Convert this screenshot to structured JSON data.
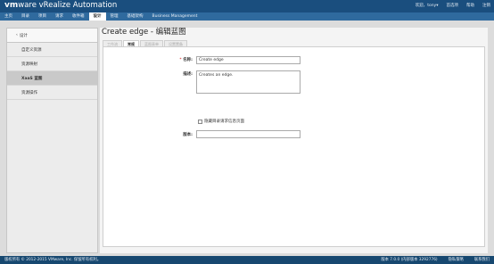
{
  "app": {
    "brand_vm": "vm",
    "brand_ware": "ware",
    "product": " vRealize Automation"
  },
  "header": {
    "user": "欢迎，",
    "user_name": "tony",
    "preferences": "首选项",
    "help": "帮助",
    "logout": "注销"
  },
  "nav": {
    "items": [
      {
        "label": "主页",
        "active": false
      },
      {
        "label": "目录",
        "active": false
      },
      {
        "label": "项目",
        "active": false
      },
      {
        "label": "请求",
        "active": false
      },
      {
        "label": "收件箱",
        "active": false
      },
      {
        "label": "设计",
        "active": true
      },
      {
        "label": "管理",
        "active": false
      },
      {
        "label": "基础架构",
        "active": false
      },
      {
        "label": "Business Management",
        "active": false
      }
    ]
  },
  "sidebar": {
    "back_label": "设计",
    "items": [
      {
        "label": "自定义资源",
        "active": false
      },
      {
        "label": "资源映射",
        "active": false
      },
      {
        "label": "XaaS 蓝图",
        "active": true
      },
      {
        "label": "资源操作",
        "active": false
      }
    ]
  },
  "page": {
    "title": "Create edge - 编辑蓝图",
    "tabs": [
      {
        "label": "工作流",
        "active": false
      },
      {
        "label": "常规",
        "active": true
      },
      {
        "label": "蓝图表单",
        "active": false
      },
      {
        "label": "设置置备",
        "active": false
      }
    ]
  },
  "form": {
    "name_label": "名称:",
    "name_value": "Create edge",
    "desc_label": "描述:",
    "desc_value": "Creates an edge.",
    "hide_checkbox_label": "隐藏目录请求信息页面",
    "hide_checked": false,
    "version_label": "版本:",
    "version_value": ""
  },
  "buttons": {
    "prev": "<上一步",
    "next": "下一步>",
    "finish": "完成",
    "cancel": "取消"
  },
  "status": {
    "copyright": "版权所有 © 2012-2015 VMware, Inc. 保留所有权利。",
    "version": "版本 7.0.0 (内部版本 3292776)",
    "privacy": "隐私策略",
    "contact": "联系我们"
  },
  "colors": {
    "topbar": "#1a4e7e",
    "navbar": "#2f6a9e",
    "statusbar": "#174870"
  }
}
